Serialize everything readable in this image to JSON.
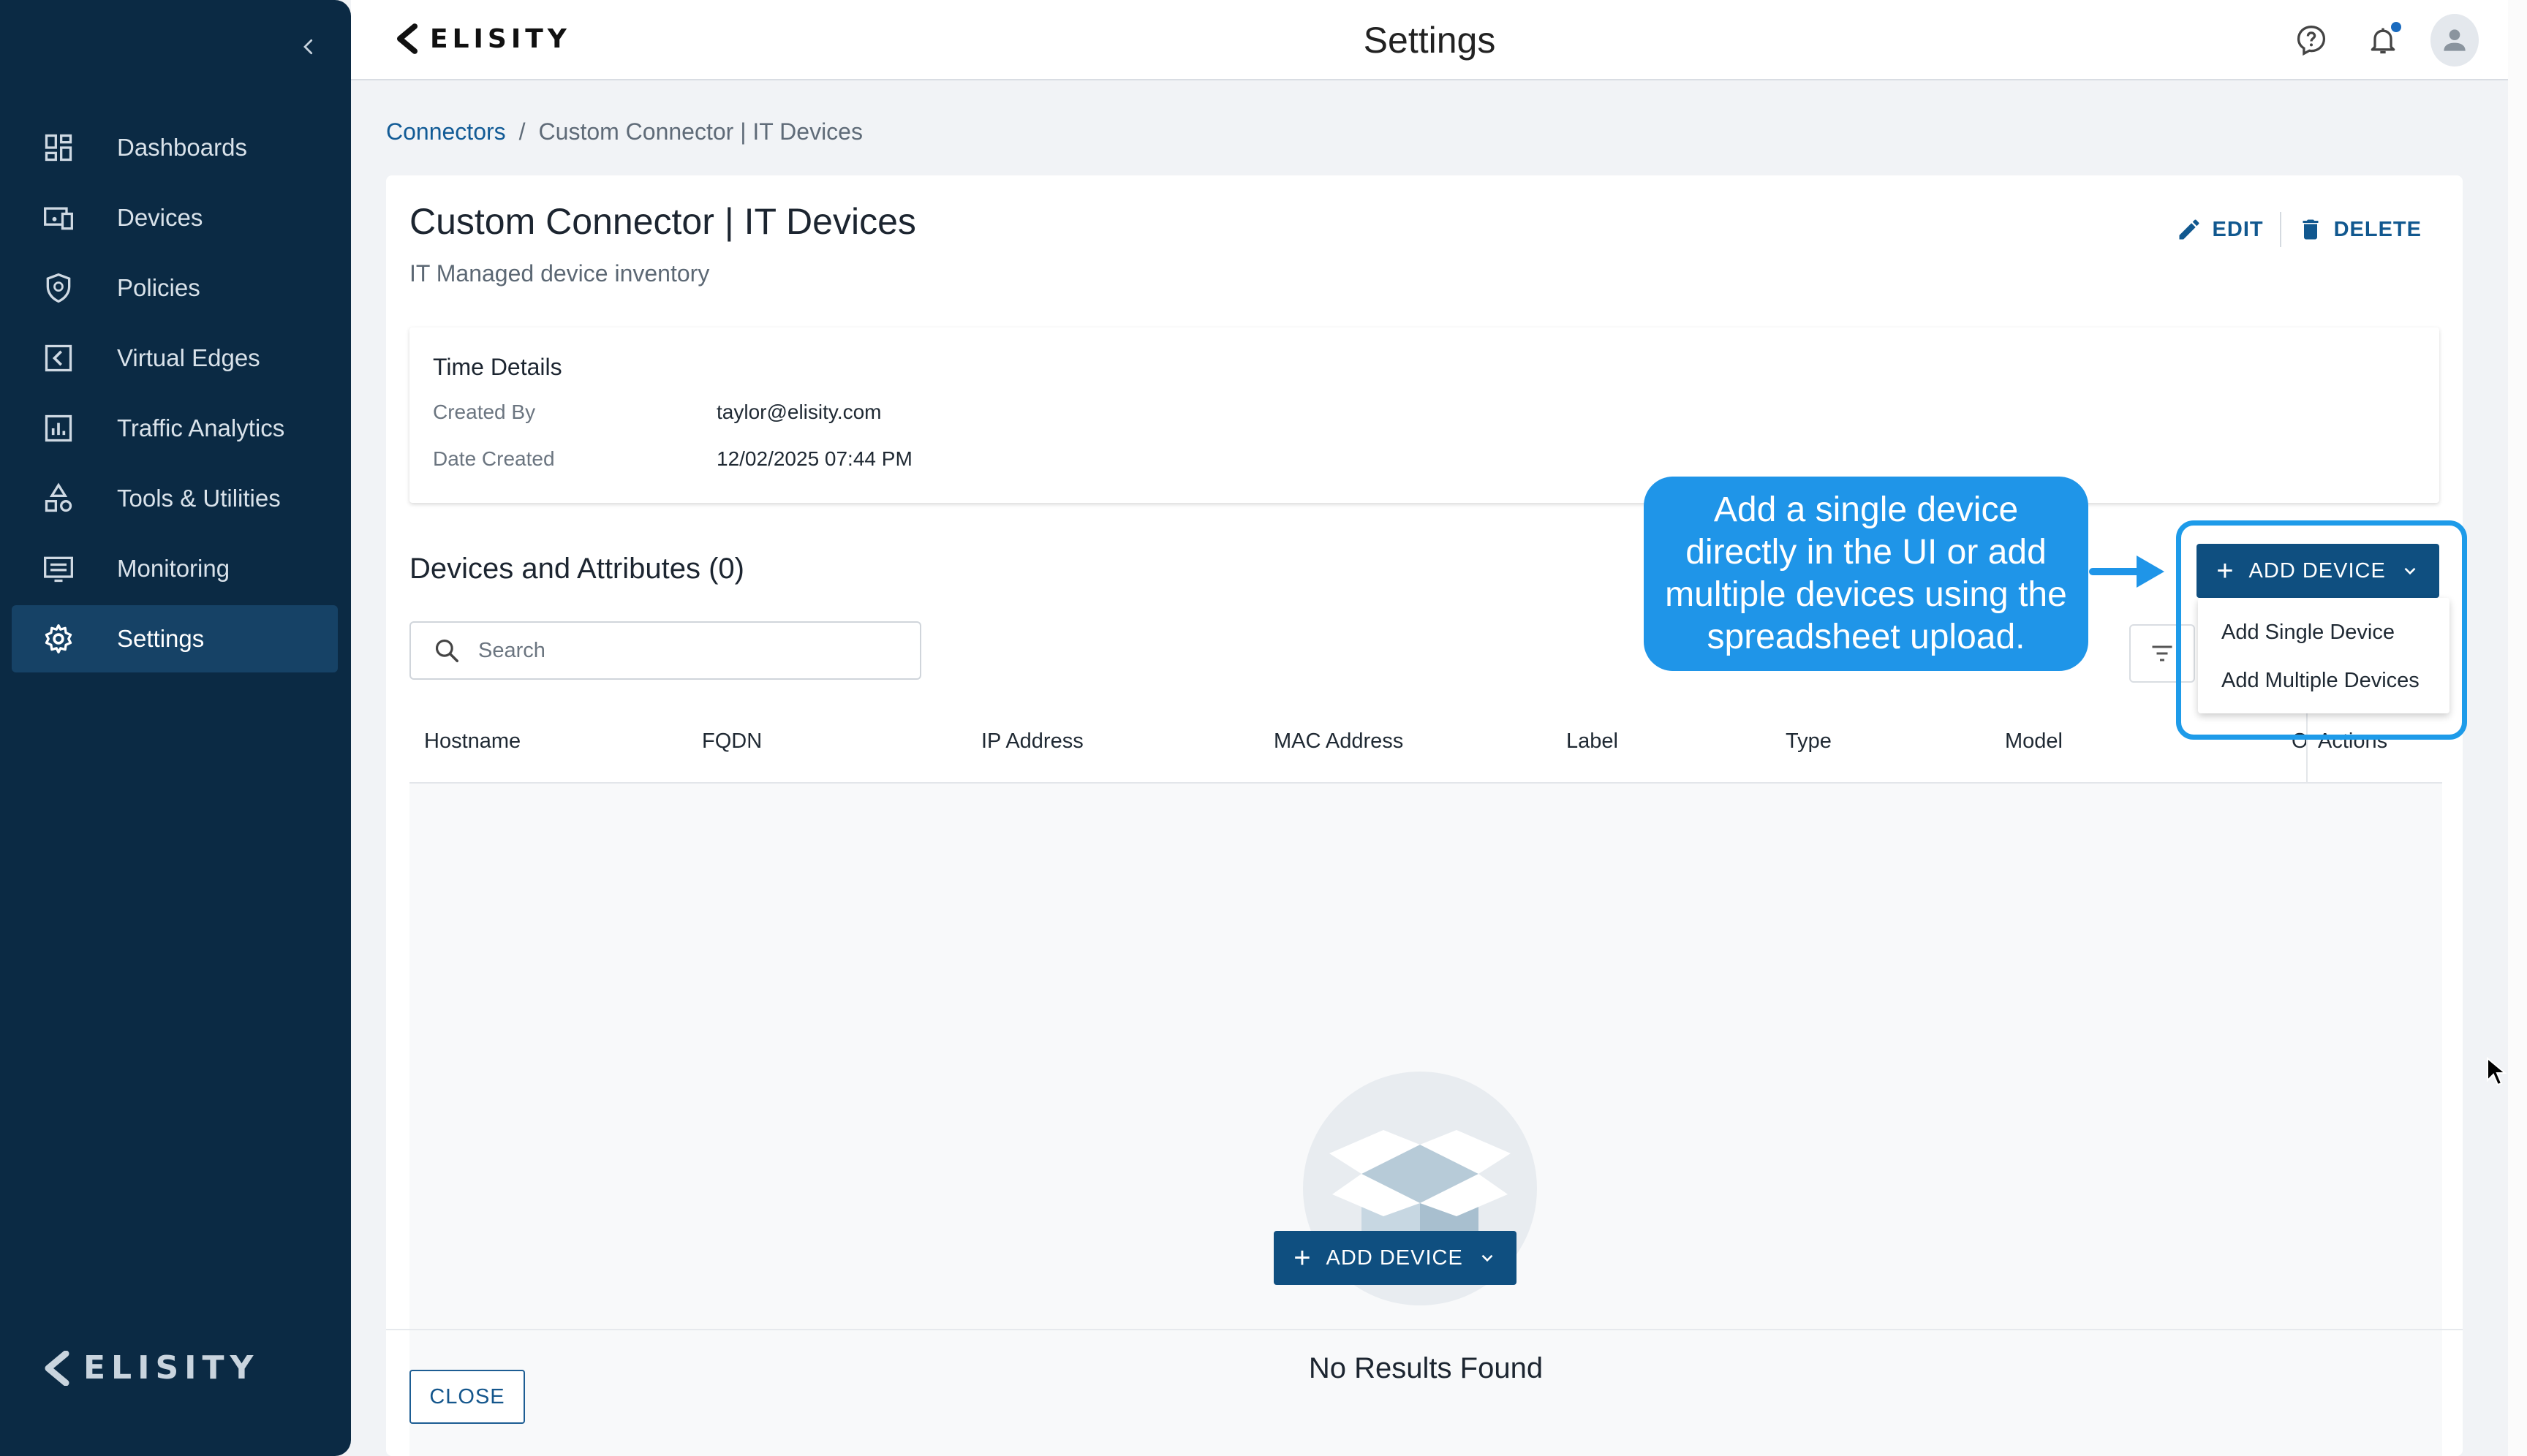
{
  "brand": {
    "name": "ELISITY"
  },
  "header": {
    "title": "Settings"
  },
  "sidebar": {
    "items": [
      {
        "label": "Dashboards",
        "icon": "dashboard-icon"
      },
      {
        "label": "Devices",
        "icon": "devices-icon"
      },
      {
        "label": "Policies",
        "icon": "shield-icon"
      },
      {
        "label": "Virtual Edges",
        "icon": "virtual-edge-icon"
      },
      {
        "label": "Traffic Analytics",
        "icon": "bar-chart-icon"
      },
      {
        "label": "Tools & Utilities",
        "icon": "shapes-icon"
      },
      {
        "label": "Monitoring",
        "icon": "monitor-icon"
      },
      {
        "label": "Settings",
        "icon": "gear-icon",
        "active": true
      }
    ]
  },
  "breadcrumb": {
    "link": "Connectors",
    "separator": "/",
    "current": "Custom Connector | IT Devices"
  },
  "connector": {
    "title": "Custom Connector | IT Devices",
    "subtitle": "IT Managed device inventory",
    "edit_label": "EDIT",
    "delete_label": "DELETE"
  },
  "time_details": {
    "title": "Time Details",
    "created_by_label": "Created By",
    "created_by_value": "taylor@elisity.com",
    "date_created_label": "Date Created",
    "date_created_value": "12/02/2025 07:44 PM"
  },
  "devices": {
    "section_title": "Devices and Attributes (0)",
    "search_placeholder": "Search",
    "columns": [
      "Hostname",
      "FQDN",
      "IP Address",
      "MAC Address",
      "Label",
      "Type",
      "Model",
      "O",
      "Actions"
    ],
    "empty_text": "No Results Found",
    "add_device_label": "ADD DEVICE",
    "close_label": "CLOSE"
  },
  "dropdown": {
    "items": [
      "Add Single Device",
      "Add Multiple Devices"
    ]
  },
  "callout": {
    "text": "Add a single device directly in the UI or add multiple devices using the spreadsheet upload."
  },
  "colors": {
    "sidebar": "#0b2a44",
    "primary": "#0f4f80",
    "callout": "#1f95e8",
    "link": "#125b96"
  }
}
